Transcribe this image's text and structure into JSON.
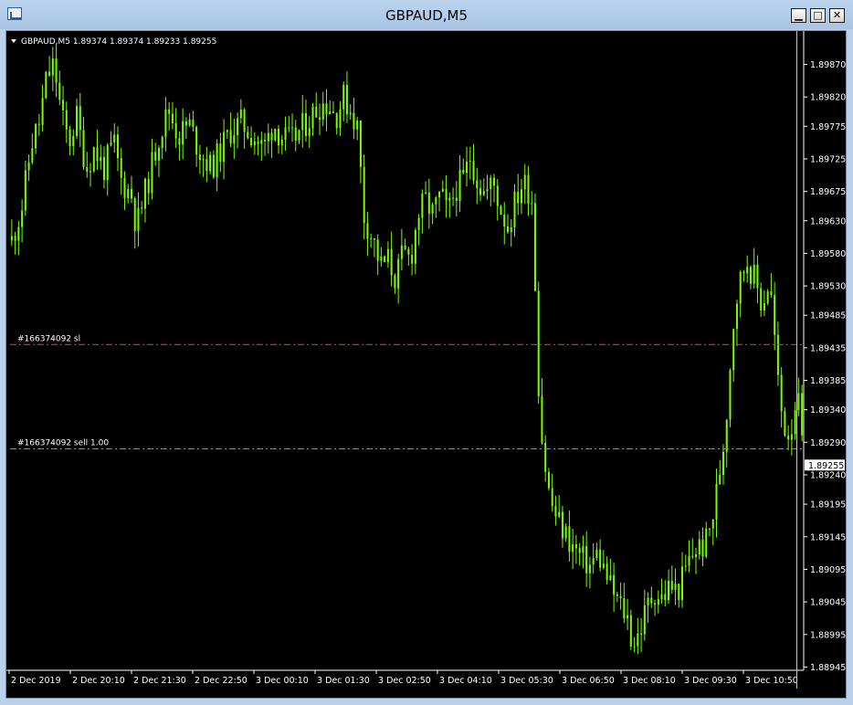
{
  "window": {
    "title": "GBPAUD,M5",
    "buttons": {
      "minimize": "▁",
      "maximize": "□",
      "close": "✕"
    }
  },
  "chart_data": {
    "type": "candlestick",
    "symbol_info": "GBPAUD,M5  1.89374 1.89374 1.89233 1.89255",
    "bid_price": 1.89255,
    "bid_label": "1.89255",
    "ylim": [
      1.8894,
      1.8991
    ],
    "y_ticks": [
      "1.89870",
      "1.89820",
      "1.89775",
      "1.89725",
      "1.89675",
      "1.89630",
      "1.89580",
      "1.89530",
      "1.89485",
      "1.89435",
      "1.89385",
      "1.89340",
      "1.89290",
      "1.89240",
      "1.89195",
      "1.89145",
      "1.89095",
      "1.89045",
      "1.88995",
      "1.88945"
    ],
    "x_ticks": [
      "2 Dec 2019",
      "2 Dec 20:10",
      "2 Dec 21:30",
      "2 Dec 22:50",
      "3 Dec 00:10",
      "3 Dec 01:30",
      "3 Dec 02:50",
      "3 Dec 04:10",
      "3 Dec 05:30",
      "3 Dec 06:50",
      "3 Dec 08:10",
      "3 Dec 09:30",
      "3 Dec 10:50"
    ],
    "levels": [
      {
        "label": "#166374092 sl",
        "price": 1.8944,
        "color": "#ff3a3a"
      },
      {
        "label": "#166374092 sell 1.00",
        "price": 1.8928,
        "color": "#33cc33"
      }
    ],
    "candle_color": "#7cfc00",
    "path_points": [
      [
        0,
        1.896
      ],
      [
        4,
        1.8965
      ],
      [
        8,
        1.8975
      ],
      [
        11,
        1.8978
      ],
      [
        14,
        1.8985
      ],
      [
        17,
        1.8987
      ],
      [
        20,
        1.8979
      ],
      [
        23,
        1.8975
      ],
      [
        26,
        1.8979
      ],
      [
        30,
        1.8971
      ],
      [
        33,
        1.8974
      ],
      [
        37,
        1.8971
      ],
      [
        41,
        1.8975
      ],
      [
        44,
        1.8969
      ],
      [
        48,
        1.8967
      ],
      [
        50,
        1.8962
      ],
      [
        54,
        1.8968
      ],
      [
        59,
        1.8976
      ],
      [
        63,
        1.898
      ],
      [
        67,
        1.8976
      ],
      [
        71,
        1.8978
      ],
      [
        75,
        1.8974
      ],
      [
        80,
        1.8971
      ],
      [
        84,
        1.8974
      ],
      [
        88,
        1.8977
      ],
      [
        92,
        1.8978
      ],
      [
        97,
        1.8976
      ],
      [
        101,
        1.8974
      ],
      [
        105,
        1.8978
      ],
      [
        108,
        1.8976
      ],
      [
        112,
        1.8975
      ],
      [
        116,
        1.8977
      ],
      [
        120,
        1.8979
      ],
      [
        124,
        1.8981
      ],
      [
        127,
        1.8981
      ],
      [
        130,
        1.8979
      ],
      [
        133,
        1.8982
      ],
      [
        136,
        1.898
      ],
      [
        139,
        1.8977
      ],
      [
        141,
        1.8964
      ],
      [
        145,
        1.896
      ],
      [
        148,
        1.8956
      ],
      [
        151,
        1.8957
      ],
      [
        154,
        1.8954
      ],
      [
        157,
        1.8958
      ],
      [
        160,
        1.8957
      ],
      [
        163,
        1.8964
      ],
      [
        166,
        1.8966
      ],
      [
        169,
        1.8964
      ],
      [
        172,
        1.8967
      ],
      [
        175,
        1.8964
      ],
      [
        178,
        1.8968
      ],
      [
        181,
        1.8969
      ],
      [
        184,
        1.8973
      ],
      [
        187,
        1.8969
      ],
      [
        190,
        1.8967
      ],
      [
        193,
        1.8969
      ],
      [
        196,
        1.8965
      ],
      [
        199,
        1.8962
      ],
      [
        202,
        1.8966
      ],
      [
        205,
        1.8969
      ],
      [
        207,
        1.8968
      ],
      [
        209,
        1.8966
      ],
      [
        211,
        1.894
      ],
      [
        213,
        1.8928
      ],
      [
        216,
        1.892
      ],
      [
        219,
        1.8917
      ],
      [
        222,
        1.8915
      ],
      [
        225,
        1.8913
      ],
      [
        229,
        1.8911
      ],
      [
        232,
        1.891
      ],
      [
        235,
        1.8912
      ],
      [
        238,
        1.8909
      ],
      [
        241,
        1.8906
      ],
      [
        244,
        1.8904
      ],
      [
        247,
        1.8902
      ],
      [
        249,
        1.8898
      ],
      [
        252,
        1.89
      ],
      [
        255,
        1.8904
      ],
      [
        258,
        1.8906
      ],
      [
        261,
        1.8905
      ],
      [
        264,
        1.8907
      ],
      [
        267,
        1.8906
      ],
      [
        270,
        1.8909
      ],
      [
        272,
        1.8911
      ],
      [
        275,
        1.8913
      ],
      [
        278,
        1.8913
      ],
      [
        281,
        1.8917
      ],
      [
        283,
        1.8922
      ],
      [
        286,
        1.893
      ],
      [
        288,
        1.894
      ],
      [
        290,
        1.895
      ],
      [
        293,
        1.8955
      ],
      [
        295,
        1.8957
      ],
      [
        298,
        1.8954
      ],
      [
        301,
        1.895
      ],
      [
        304,
        1.8954
      ],
      [
        306,
        1.8945
      ],
      [
        308,
        1.8935
      ],
      [
        311,
        1.893
      ],
      [
        313,
        1.8932
      ],
      [
        315,
        1.8937
      ],
      [
        317,
        1.8929
      ]
    ]
  }
}
